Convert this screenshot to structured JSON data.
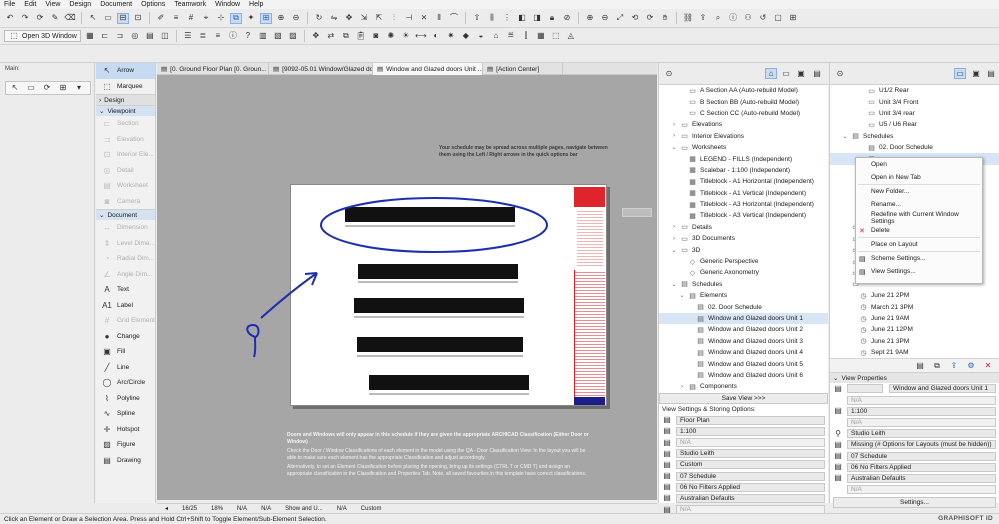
{
  "menubar": [
    "File",
    "Edit",
    "View",
    "Design",
    "Document",
    "Options",
    "Teamwork",
    "Window",
    "Help"
  ],
  "toolbar2": {
    "open3d_label": "Open 3D Window"
  },
  "mainpanel": {
    "label": "Main:"
  },
  "toolbox": {
    "arrow": "Arrow",
    "marquee": "Marquee",
    "design_group": "Design",
    "viewpoint_group": "Viewpoint",
    "viewpoint_tools": [
      "Section",
      "Elevation",
      "Interior Ele...",
      "Detail",
      "Worksheet",
      "Camera"
    ],
    "document_group": "Document",
    "doc_tools_dim": [
      "Dimension",
      "Level Dime...",
      "Radial Dim...",
      "Angle Dim..."
    ],
    "doc_tools": [
      {
        "label": "Text",
        "icon": "A",
        "dim": false
      },
      {
        "label": "Label",
        "icon": "A1",
        "dim": false
      },
      {
        "label": "Grid Element",
        "icon": "#",
        "dim": true
      },
      {
        "label": "Change",
        "icon": "●",
        "dim": false
      },
      {
        "label": "Fill",
        "icon": "▣",
        "dim": false
      },
      {
        "label": "Line",
        "icon": "╱",
        "dim": false
      },
      {
        "label": "Arc/Circle",
        "icon": "◯",
        "dim": false
      },
      {
        "label": "Polyline",
        "icon": "⌇",
        "dim": false
      },
      {
        "label": "Spline",
        "icon": "∿",
        "dim": false
      },
      {
        "label": "Hotspot",
        "icon": "✛",
        "dim": false
      },
      {
        "label": "Figure",
        "icon": "▨",
        "dim": false
      },
      {
        "label": "Drawing",
        "icon": "▤",
        "dim": false
      }
    ]
  },
  "tabs": [
    {
      "label": "[0. Ground Floor Plan [0. Groun...",
      "active": false
    },
    {
      "label": "[9092-05.01 Window/Glazed doo...",
      "active": false
    },
    {
      "label": "Window and Glazed doors Unit ...",
      "active": true
    },
    {
      "label": "[Action Center]",
      "active": false
    }
  ],
  "canvas": {
    "note_top_1": "Your schedule may be spread across multiple pages, navigate between",
    "note_top_2": "them using the Left / Right arrows in the quick options bar",
    "note_bottom_1": "Doors and Windows will only appear in this schedule if they are given the appropriate ARCHICAD Classification (Either Door or",
    "note_bottom_2": "Window)",
    "note_bottom_3": "Check the Door / Window Classifications of each element in the model using the QA - Door Classification View. In the layout you will be",
    "note_bottom_4": "able to make sure each element has the appropriate Classification and adjust accordingly.",
    "note_bottom_5": "Alternatively, to set an Element Classification before placing the opening, bring up its settings (CTRL T or CMD T) and assign an",
    "note_bottom_6": "appropriate classification in the Classification and Properties Tab. Note, all saved favourites in this template have correct classifications."
  },
  "canvas_status": {
    "page": "16/25",
    "zoom": "18%",
    "na1": "N/A",
    "na2": "N/A",
    "save_label": "Show and U...",
    "na3": "N/A",
    "custom": "Custom"
  },
  "status_message": "Click an Element or Draw a Selection Area. Press and Hold Ctrl+Shift to Toggle Element/Sub-Element Selection.",
  "navigator1": {
    "rows": [
      {
        "indent": 2,
        "arrow": "",
        "icon": "▭",
        "label": "A Section AA (Auto-rebuild Model)",
        "sel": false
      },
      {
        "indent": 2,
        "arrow": "",
        "icon": "▭",
        "label": "B Section BB (Auto-rebuild Model)",
        "sel": false
      },
      {
        "indent": 2,
        "arrow": "",
        "icon": "▭",
        "label": "C Section CC (Auto-rebuild Model)",
        "sel": false
      },
      {
        "indent": 1,
        "arrow": "›",
        "icon": "▭",
        "label": "Elevations",
        "sel": false
      },
      {
        "indent": 1,
        "arrow": "›",
        "icon": "▭",
        "label": "Interior Elevations",
        "sel": false
      },
      {
        "indent": 1,
        "arrow": "⌄",
        "icon": "▭",
        "label": "Worksheets",
        "sel": false
      },
      {
        "indent": 2,
        "arrow": "",
        "icon": "▦",
        "label": "LEGEND - FILLS (Independent)",
        "sel": false
      },
      {
        "indent": 2,
        "arrow": "",
        "icon": "▦",
        "label": "Scalebar - 1:100 (Independent)",
        "sel": false
      },
      {
        "indent": 2,
        "arrow": "",
        "icon": "▦",
        "label": "Titleblock - A1 Horizontal (Independent)",
        "sel": false
      },
      {
        "indent": 2,
        "arrow": "",
        "icon": "▦",
        "label": "Titleblock - A1 Vertical (Independent)",
        "sel": false
      },
      {
        "indent": 2,
        "arrow": "",
        "icon": "▦",
        "label": "Titleblock - A3 Horizontal (Independent)",
        "sel": false
      },
      {
        "indent": 2,
        "arrow": "",
        "icon": "▦",
        "label": "Titleblock - A3 Vertical (Independent)",
        "sel": false
      },
      {
        "indent": 1,
        "arrow": "›",
        "icon": "▭",
        "label": "Details",
        "sel": false
      },
      {
        "indent": 1,
        "arrow": "›",
        "icon": "▭",
        "label": "3D Documents",
        "sel": false
      },
      {
        "indent": 1,
        "arrow": "⌄",
        "icon": "▭",
        "label": "3D",
        "sel": false
      },
      {
        "indent": 2,
        "arrow": "",
        "icon": "◇",
        "label": "Generic Perspective",
        "sel": false
      },
      {
        "indent": 2,
        "arrow": "",
        "icon": "◇",
        "label": "Generic Axonometry",
        "sel": false
      },
      {
        "indent": 1,
        "arrow": "⌄",
        "icon": "▤",
        "label": "Schedules",
        "sel": false
      },
      {
        "indent": 2,
        "arrow": "⌄",
        "icon": "▤",
        "label": "Elements",
        "sel": false
      },
      {
        "indent": 3,
        "arrow": "",
        "icon": "▤",
        "label": "02. Door Schedule",
        "sel": false
      },
      {
        "indent": 3,
        "arrow": "",
        "icon": "▤",
        "label": "Window and Glazed doors Unit 1",
        "sel": true
      },
      {
        "indent": 3,
        "arrow": "",
        "icon": "▤",
        "label": "Window and Glazed doors Unit 2",
        "sel": false
      },
      {
        "indent": 3,
        "arrow": "",
        "icon": "▤",
        "label": "Window and Glazed doors Unit 3",
        "sel": false
      },
      {
        "indent": 3,
        "arrow": "",
        "icon": "▤",
        "label": "Window and Glazed doors Unit 4",
        "sel": false
      },
      {
        "indent": 3,
        "arrow": "",
        "icon": "▤",
        "label": "Window and Glazed doors Unit 5",
        "sel": false
      },
      {
        "indent": 3,
        "arrow": "",
        "icon": "▤",
        "label": "Window and Glazed doors Unit 6",
        "sel": false
      },
      {
        "indent": 2,
        "arrow": "›",
        "icon": "▤",
        "label": "Components",
        "sel": false
      }
    ],
    "save_view": "Save View >>>",
    "options_title": "View Settings & Storing Options:",
    "options": [
      {
        "icon": "▤",
        "value": "Floor Plan",
        "dim": false
      },
      {
        "icon": "▤",
        "value": "1:100",
        "dim": false
      },
      {
        "icon": "▤",
        "value": "N/A",
        "dim": true
      },
      {
        "icon": "▤",
        "value": "Studio Leith",
        "dim": false
      },
      {
        "icon": "▤",
        "value": "Custom",
        "dim": false
      },
      {
        "icon": "▤",
        "value": "07 Schedule",
        "dim": false
      },
      {
        "icon": "▤",
        "value": "06 No Filters Applied",
        "dim": false
      },
      {
        "icon": "▤",
        "value": "Australian Defaults",
        "dim": false
      },
      {
        "icon": "▤",
        "value": "N/A",
        "dim": true
      }
    ]
  },
  "navigator2": {
    "rows": [
      {
        "indent": 3,
        "arrow": "",
        "icon": "▭",
        "label": "U1/2 Rear",
        "sel": false
      },
      {
        "indent": 3,
        "arrow": "",
        "icon": "▭",
        "label": "Unit 3/4 Front",
        "sel": false
      },
      {
        "indent": 3,
        "arrow": "",
        "icon": "▭",
        "label": "Unit 3/4 rear",
        "sel": false
      },
      {
        "indent": 3,
        "arrow": "",
        "icon": "▭",
        "label": "U5 / U6 Rear",
        "sel": false
      },
      {
        "indent": 1,
        "arrow": "⌄",
        "icon": "▤",
        "label": "Schedules",
        "sel": false
      },
      {
        "indent": 3,
        "arrow": "",
        "icon": "▤",
        "label": "02. Door Schedule",
        "sel": false
      },
      {
        "indent": 3,
        "arrow": "",
        "icon": "▤",
        "label": "",
        "sel": true
      },
      {
        "indent": 0,
        "arrow": "",
        "icon": "",
        "label": "",
        "sel": false
      },
      {
        "indent": 0,
        "arrow": "",
        "icon": "",
        "label": "",
        "sel": false
      },
      {
        "indent": 0,
        "arrow": "",
        "icon": "",
        "label": "",
        "sel": false
      },
      {
        "indent": 0,
        "arrow": "",
        "icon": "",
        "label": "",
        "sel": false
      },
      {
        "indent": 0,
        "arrow": "",
        "icon": "",
        "label": "",
        "sel": false
      },
      {
        "indent": 1,
        "arrow": "",
        "icon": "▭",
        "label": "",
        "sel": false
      },
      {
        "indent": 1,
        "arrow": "",
        "icon": "▭",
        "label": "",
        "sel": false
      },
      {
        "indent": 1,
        "arrow": "",
        "icon": "▭",
        "label": "",
        "sel": false
      },
      {
        "indent": 1,
        "arrow": "",
        "icon": "▭",
        "label": "",
        "sel": false
      },
      {
        "indent": 1,
        "arrow": "",
        "icon": "▭",
        "label": "",
        "sel": false
      },
      {
        "indent": 1,
        "arrow": "",
        "icon": "▭",
        "label": "",
        "sel": false
      },
      {
        "indent": 2,
        "arrow": "",
        "icon": "◷",
        "label": "June 21 2PM",
        "sel": false
      },
      {
        "indent": 2,
        "arrow": "",
        "icon": "◷",
        "label": "March 21 3PM",
        "sel": false
      },
      {
        "indent": 2,
        "arrow": "",
        "icon": "◷",
        "label": "June 21 9AM",
        "sel": false
      },
      {
        "indent": 2,
        "arrow": "",
        "icon": "◷",
        "label": "June 21 12PM",
        "sel": false
      },
      {
        "indent": 2,
        "arrow": "",
        "icon": "◷",
        "label": "June 21 3PM",
        "sel": false
      },
      {
        "indent": 2,
        "arrow": "",
        "icon": "◷",
        "label": "Sept 21 9AM",
        "sel": false
      }
    ],
    "view_properties": "View Properties",
    "name_value": "Window and Glazed doors Unit 1",
    "props": [
      {
        "icon": "",
        "value": "N/A",
        "dim": true
      },
      {
        "icon": "▤",
        "value": "1:100",
        "dim": false
      },
      {
        "icon": "",
        "value": "N/A",
        "dim": true
      },
      {
        "icon": "⚲",
        "value": "Studio Leith",
        "dim": false
      },
      {
        "icon": "▤",
        "value": "Missing (# Options for Layouts (must be hidden))",
        "dim": false
      },
      {
        "icon": "▤",
        "value": "07 Schedule",
        "dim": false
      },
      {
        "icon": "▤",
        "value": "06 No Filters Applied",
        "dim": false
      },
      {
        "icon": "▤",
        "value": "Australian Defaults",
        "dim": false
      },
      {
        "icon": "",
        "value": "N/A",
        "dim": true
      }
    ],
    "settings_btn": "Settings...",
    "brand": "GRAPHISOFT ID"
  },
  "context_menu": [
    {
      "label": "Open",
      "icon": "",
      "sep_after": false
    },
    {
      "label": "Open in New Tab",
      "icon": "",
      "sep_after": true
    },
    {
      "label": "New Folder...",
      "icon": "",
      "sep_after": false
    },
    {
      "label": "Rename...",
      "icon": "",
      "sep_after": false
    },
    {
      "label": "Redefine with Current Window Settings",
      "icon": "",
      "sep_after": false
    },
    {
      "label": "Delete",
      "icon": "✕",
      "sep_after": true
    },
    {
      "label": "Place on Layout",
      "icon": "",
      "sep_after": true
    },
    {
      "label": "Scheme Settings...",
      "icon": "▤",
      "sep_after": false
    },
    {
      "label": "View Settings...",
      "icon": "▤",
      "sep_after": false
    }
  ],
  "colors": {
    "accent": "#2a63b8",
    "annotation": "#1d2fb0",
    "sheet_red": "#e0242c"
  }
}
